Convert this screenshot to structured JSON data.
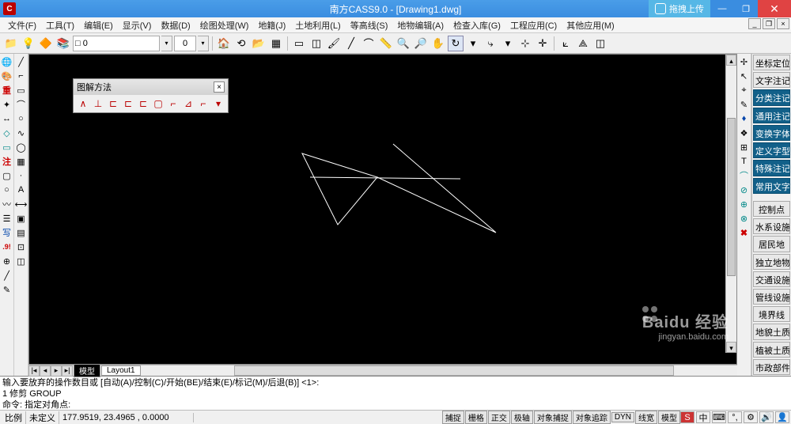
{
  "title": "南方CASS9.0 - [Drawing1.dwg]",
  "titlebar": {
    "icon_letter": "C",
    "upload_label": "拖拽上传"
  },
  "menu": [
    "文件(F)",
    "工具(T)",
    "编辑(E)",
    "显示(V)",
    "数据(D)",
    "绘图处理(W)",
    "地籍(J)",
    "土地利用(L)",
    "等高线(S)",
    "地物编辑(A)",
    "检查入库(G)",
    "工程应用(C)",
    "其他应用(M)"
  ],
  "toolbar_icons": [
    "folder",
    "bulb",
    "palette",
    "layer-manage"
  ],
  "layer_value": "□ 0",
  "field_value": "0",
  "toolbar2_icons": [
    "home",
    "aback",
    "open",
    "grid",
    "sel",
    "sel2",
    "brush",
    "line",
    "arc",
    "measure",
    "zoom-in",
    "zoom-out",
    "pan",
    "orbit",
    "arrow-dd",
    "redo",
    "pick",
    "cross",
    "axis",
    "axis2",
    "cube"
  ],
  "left_tb_a": [
    {
      "n": "earth",
      "g": "🌐",
      "c": ""
    },
    {
      "n": "palette",
      "g": "🎨",
      "c": ""
    },
    {
      "n": "zhong",
      "g": "重",
      "c": "red"
    },
    {
      "n": "axis",
      "g": "✦",
      "c": ""
    },
    {
      "n": "move",
      "g": "↔",
      "c": ""
    },
    {
      "n": "green1",
      "g": "◇",
      "c": "teal"
    },
    {
      "n": "green2",
      "g": "▭",
      "c": "teal"
    },
    {
      "n": "zhu",
      "g": "注",
      "c": "red"
    },
    {
      "n": "rect",
      "g": "▢",
      "c": ""
    },
    {
      "n": "circle",
      "g": "○",
      "c": ""
    },
    {
      "n": "wave",
      "g": "〰",
      "c": ""
    },
    {
      "n": "text",
      "g": "☰",
      "c": ""
    },
    {
      "n": "xie",
      "g": "写",
      "c": "blue"
    },
    {
      "n": "num",
      "g": ".9!",
      "c": "red"
    },
    {
      "n": "plus",
      "g": "⊕",
      "c": ""
    },
    {
      "n": "slash",
      "g": "╱",
      "c": ""
    },
    {
      "n": "dot",
      "g": "✎",
      "c": ""
    }
  ],
  "left_tb_b": [
    {
      "n": "line",
      "g": "╱"
    },
    {
      "n": "pline",
      "g": "⌐"
    },
    {
      "n": "rect",
      "g": "▭"
    },
    {
      "n": "arc",
      "g": "⌒"
    },
    {
      "n": "circle",
      "g": "○"
    },
    {
      "n": "spline",
      "g": "∿"
    },
    {
      "n": "ellipse",
      "g": "◯"
    },
    {
      "n": "hatch",
      "g": "▦"
    },
    {
      "n": "pt",
      "g": "·"
    },
    {
      "n": "text",
      "g": "A"
    },
    {
      "n": "dim",
      "g": "⟷"
    },
    {
      "n": "block",
      "g": "▣"
    },
    {
      "n": "table",
      "g": "▤"
    },
    {
      "n": "m1",
      "g": "⊡"
    },
    {
      "n": "m2",
      "g": "◫"
    }
  ],
  "float_toolbar": {
    "title": "图解方法",
    "btns": [
      "∧",
      "⊥",
      "⊏",
      "⊏",
      "⊏",
      "▢",
      "⌐",
      "⊿",
      "⌐",
      "▾"
    ]
  },
  "tabs": {
    "model": "模型",
    "layout": "Layout1"
  },
  "right_tb": [
    {
      "n": "r1",
      "g": "✢"
    },
    {
      "n": "r2",
      "g": "↖"
    },
    {
      "n": "r3",
      "g": "⌖"
    },
    {
      "n": "r4",
      "g": "✎"
    },
    {
      "n": "r5",
      "g": "♦",
      "c": "blue"
    },
    {
      "n": "r6",
      "g": "❖"
    },
    {
      "n": "r7",
      "g": "⊞"
    },
    {
      "n": "r8",
      "g": "T"
    },
    {
      "n": "r9",
      "g": "⌒",
      "c": "teal"
    },
    {
      "n": "r10",
      "g": "⊘",
      "c": "teal"
    },
    {
      "n": "r11",
      "g": "⊕",
      "c": "teal"
    },
    {
      "n": "r12",
      "g": "⊗",
      "c": "teal"
    },
    {
      "n": "rx",
      "g": "✖",
      "c": "red"
    }
  ],
  "right_panel_top": [
    {
      "label": "坐标定位",
      "hl": false
    },
    {
      "label": "文字注记",
      "hl": false
    },
    {
      "label": "分类注记",
      "hl": true
    },
    {
      "label": "通用注记",
      "hl": true
    },
    {
      "label": "变换字体",
      "hl": true
    },
    {
      "label": "定义字型",
      "hl": true
    },
    {
      "label": "特殊注记",
      "hl": true
    },
    {
      "label": "常用文字",
      "hl": true
    }
  ],
  "right_panel_bottom": [
    "控制点",
    "水系设施",
    "居民地",
    "独立地物",
    "交通设施",
    "管线设施",
    "境界线",
    "地貌土质",
    "植被土质",
    "市政部件"
  ],
  "cmd": {
    "l1": "输入要放弃的操作数目或 [自动(A)/控制(C)/开始(BE)/结束(E)/标记(M)/后退(B)] <1>:",
    "l2": "1 修剪  GROUP",
    "l3": "命令: 指定对角点:"
  },
  "status": {
    "scale_label": "比例",
    "scale_value": "未定义",
    "coords": "177.9519, 23.4965 , 0.0000",
    "toggles": [
      "捕捉",
      "栅格",
      "正交",
      "极轴",
      "对象捕捉",
      "对象追踪",
      "DYN",
      "线宽",
      "模型"
    ]
  },
  "watermark": {
    "brand": "Baidu 经验",
    "site": "jingyan.baidu.com"
  }
}
